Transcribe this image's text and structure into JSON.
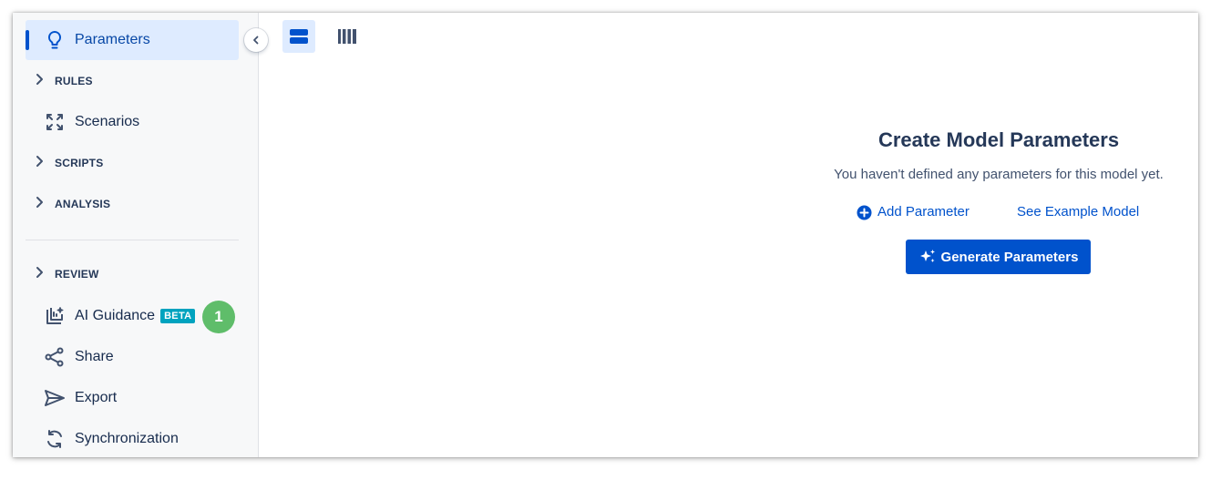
{
  "sidebar": {
    "active_item": {
      "label": "Parameters",
      "icon": "lightbulb-icon"
    },
    "sections": {
      "rules": "RULES",
      "scripts": "SCRIPTS",
      "analysis": "ANALYSIS",
      "review": "REVIEW"
    },
    "items": {
      "scenarios": {
        "label": "Scenarios",
        "icon": "scenarios-expand-icon"
      },
      "ai_guidance": {
        "label": "AI Guidance",
        "badge": "BETA",
        "count": "1",
        "icon": "ai-guidance-icon"
      },
      "share": {
        "label": "Share",
        "icon": "share-icon"
      },
      "export": {
        "label": "Export",
        "icon": "send-icon"
      },
      "synchronization": {
        "label": "Synchronization",
        "icon": "sync-icon"
      }
    },
    "collapse_icon": "chevron-left-icon"
  },
  "toolbar": {
    "list_view_icon": "list-view-icon",
    "board_view_icon": "board-view-icon"
  },
  "empty_state": {
    "title": "Create Model Parameters",
    "description": "You haven't defined any parameters for this model yet.",
    "add_parameter": "Add Parameter",
    "see_example": "See Example Model",
    "generate_button": "Generate Parameters"
  },
  "colors": {
    "accent": "#0052cc",
    "active_bg": "#deebff",
    "badge_beta": "#00a3bf",
    "count_badge": "#5fbd6a",
    "sidebar_bg": "#f7f8f9"
  }
}
